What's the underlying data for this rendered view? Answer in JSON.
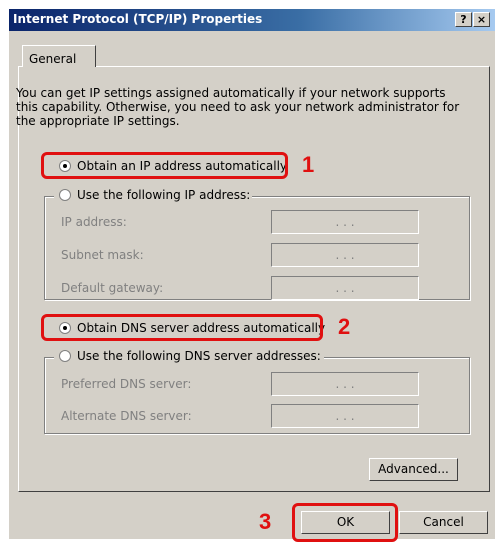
{
  "window": {
    "title": "Internet Protocol (TCP/IP) Properties",
    "help_button": "?",
    "close_button": "×"
  },
  "tabs": [
    {
      "label": "General"
    }
  ],
  "description": "You can get IP settings assigned automatically if your network supports this capability. Otherwise, you need to ask your network administrator for the appropriate IP settings.",
  "ip": {
    "auto_label": "Obtain an IP address automatically",
    "manual_label": "Use the following IP address:",
    "fields": [
      {
        "label": "IP address:",
        "value": ". . ."
      },
      {
        "label": "Subnet mask:",
        "value": ". . ."
      },
      {
        "label": "Default gateway:",
        "value": ". . ."
      }
    ]
  },
  "dns": {
    "auto_label": "Obtain DNS server address automatically",
    "manual_label": "Use the following DNS server addresses:",
    "fields": [
      {
        "label": "Preferred DNS server:",
        "value": ". . ."
      },
      {
        "label": "Alternate DNS server:",
        "value": ". . ."
      }
    ]
  },
  "buttons": {
    "advanced": "Advanced...",
    "ok": "OK",
    "cancel": "Cancel"
  },
  "annotations": {
    "step1": "1",
    "step2": "2",
    "step3": "3"
  },
  "colors": {
    "highlight": "#e01010",
    "title_bar": "#0a246a",
    "dialog_bg": "#d4d0c8"
  },
  "icons": {
    "help": "question-mark-icon",
    "close": "close-icon"
  }
}
